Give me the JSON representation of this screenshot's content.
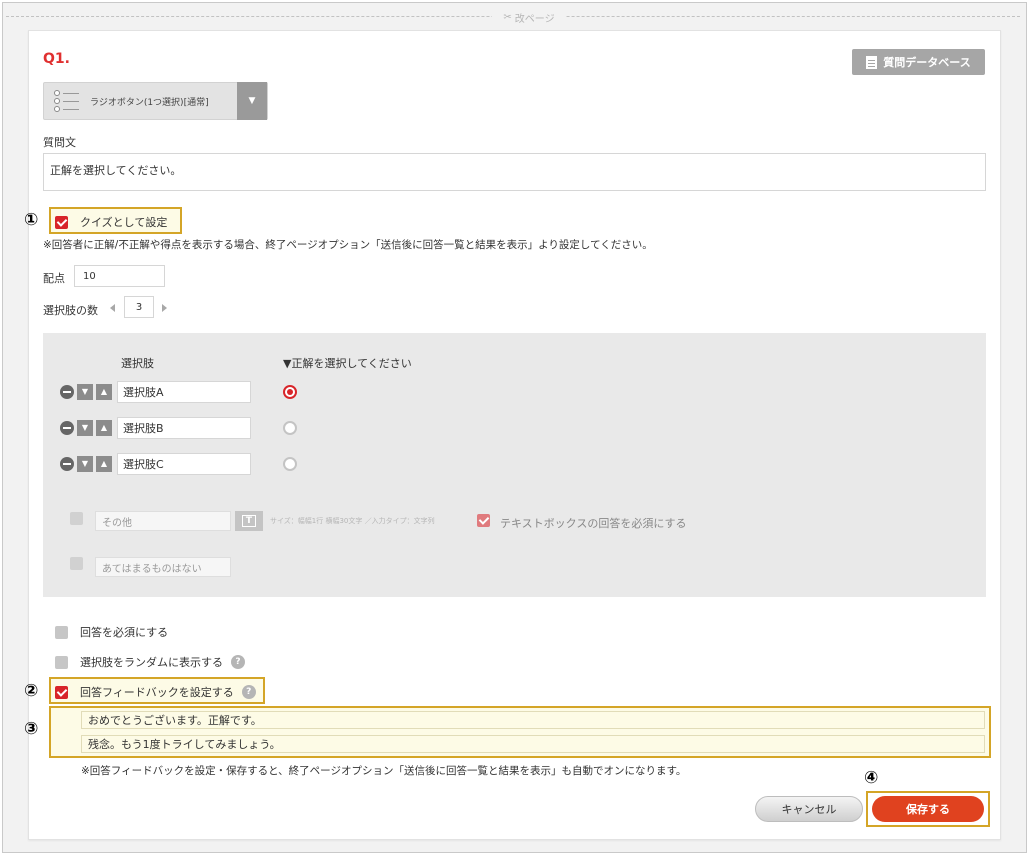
{
  "page_break": {
    "label": "改ページ",
    "icon": "scissors-icon"
  },
  "question": {
    "number": "Q1.",
    "database_button": "質問データベース",
    "type_label": "ラジオボタン(1つ選択)[通常]",
    "text_label": "質問文",
    "text_value": "正解を選択してください。"
  },
  "quiz": {
    "checkbox_label": "クイズとして設定",
    "checked": true,
    "note": "※回答者に正解/不正解や得点を表示する場合、終了ページオプション「送信後に回答一覧と結果を表示」より設定してください。",
    "points_label": "配点",
    "points_value": "10",
    "choice_count_label": "選択肢の数",
    "choice_count_value": "3"
  },
  "choices_panel": {
    "column_choice": "選択肢",
    "column_correct": "▼正解を選択してください",
    "items": [
      {
        "label": "選択肢A",
        "correct": true
      },
      {
        "label": "選択肢B",
        "correct": false
      },
      {
        "label": "選択肢C",
        "correct": false
      }
    ],
    "other_placeholder": "その他",
    "other_hint": "サイズ：幅幅1行 横幅30文字 ／入力タイプ：文字列",
    "textbox_required_label": "テキストボックスの回答を必須にする",
    "none_placeholder": "あてはまるものはない"
  },
  "options": {
    "required_label": "回答を必須にする",
    "random_label": "選択肢をランダムに表示する",
    "feedback_label": "回答フィードバックを設定する"
  },
  "feedback": {
    "correct_text": "おめでとうございます。正解です。",
    "incorrect_text": "残念。もう1度トライしてみましょう。",
    "note": "※回答フィードバックを設定・保存すると、終了ページオプション「送信後に回答一覧と結果を表示」も自動でオンになります。"
  },
  "annotations": [
    "①",
    "②",
    "③",
    "④"
  ],
  "buttons": {
    "cancel": "キャンセル",
    "save": "保存する"
  },
  "colors": {
    "accent": "#d8252a",
    "save": "#e0421f",
    "highlight_border": "#d4a527"
  }
}
